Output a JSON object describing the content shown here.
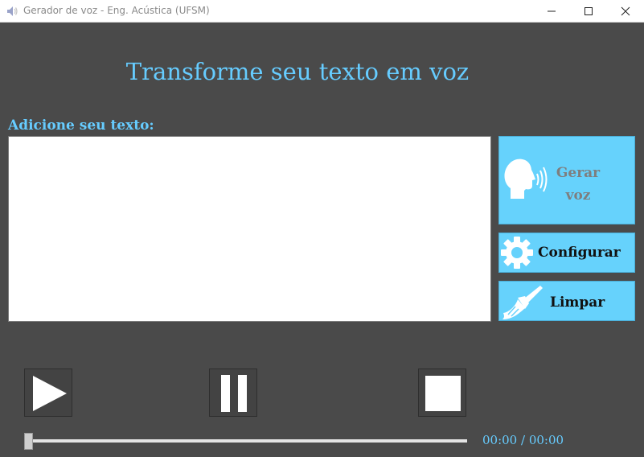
{
  "window": {
    "title": "Gerador de voz - Eng. Acústica (UFSM)"
  },
  "main": {
    "title": "Transforme seu texto em voz",
    "input_label": "Adicione seu texto:",
    "text_value": ""
  },
  "actions": {
    "generate_line1": "Gerar",
    "generate_line2": "voz",
    "configure": "Configurar",
    "clear": "Limpar"
  },
  "player": {
    "time": "00:00 / 00:00",
    "progress": 0
  },
  "icons": {
    "app": "speaker-icon",
    "generate": "speaking-head-icon",
    "configure": "gear-icon",
    "clear": "broom-icon",
    "play": "play-icon",
    "pause": "pause-icon",
    "stop": "stop-icon"
  },
  "colors": {
    "background": "#4a4a4a",
    "accent": "#66ccff",
    "button_fill": "#66d2fc"
  }
}
